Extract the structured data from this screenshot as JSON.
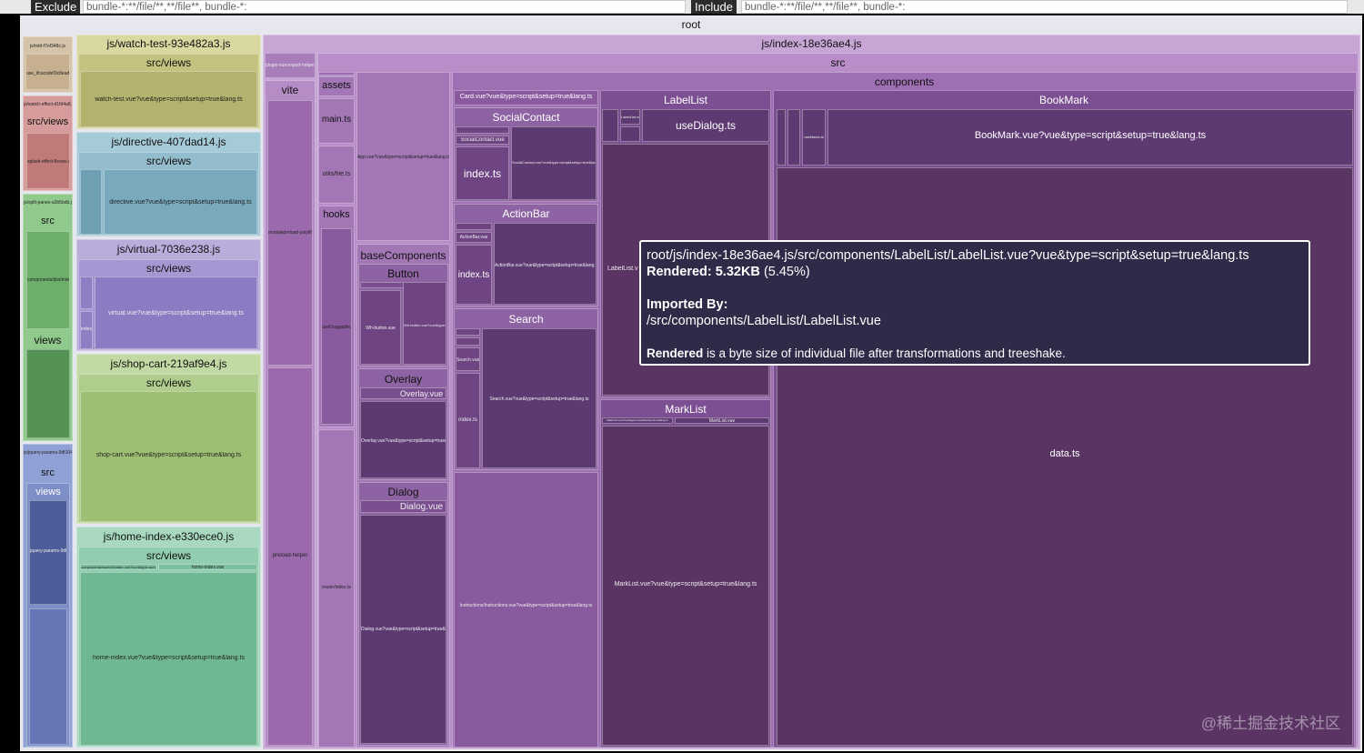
{
  "filters": {
    "exclude_label": "Exclude",
    "exclude_value": "bundle-*:**/file/**,**/file**, bundle-*:",
    "include_label": "Include",
    "include_value": "bundle-*:**/file/**,**/file**, bundle-*:"
  },
  "treemap": {
    "root": "root",
    "left_chunks": {
      "mitt": "js/mitt-f7ef348c.js",
      "mitt_sub": "use_ifcacodef3c8eaddfc.ts",
      "splash": "js/watch-effect-d1fd4a8.js",
      "splash_views": "src/views",
      "splash_child": "splash-effect-flexes.vue",
      "splitpane": "js/split-panes-a2b5bdb.js",
      "splitpane_src": "src",
      "splitpane_child": "components/dist/index.js",
      "splitpane_views": "views",
      "jquery": "js/jquery-params-9df1040.js",
      "jquery_src": "src",
      "jquery_views": "views",
      "jquery_child": "jquery-params-9df1040.vue"
    },
    "watch_test": {
      "title": "js/watch-test-93e482a3.js",
      "views": "src/views",
      "file": "watch-test.vue?vue&type=script&setup=true&lang.ts"
    },
    "directive": {
      "title": "js/directive-407dad14.js",
      "views": "src/views",
      "file": "directive.vue?vue&type=script&setup=true&lang.ts"
    },
    "virtual": {
      "title": "js/virtual-7036e238.js",
      "views": "src/views",
      "file": "virtual.vue?vue&type=script&setup=true&lang.ts",
      "small": "index.ts"
    },
    "shop_cart": {
      "title": "js/shop-cart-219af9e4.js",
      "views": "src/views",
      "file": "shop-cart.vue?vue&type=script&setup=true&lang.ts"
    },
    "home_index": {
      "title": "js/home-index-e330ece0.js",
      "views": "src/views",
      "sub1": "components/HomeHeader.vue?vue&type=script&setup=true&lang.ts",
      "sub2": "home-index.vue",
      "file": "home-index.vue?vue&type=script&setup=true&lang.ts"
    },
    "index_chunk": {
      "title": "js/index-18e36ae4.js",
      "src": "src",
      "components": "components",
      "plugin": "plugin-vue:export-helper",
      "vite": "vite",
      "vite_child1": "modulepreload-polyfill",
      "vite_child2": "preload-helper",
      "assets": "assets",
      "main": "main.ts",
      "app": "App.vue?vue&type=script&setup=true&lang.ts",
      "utils": "utils/file.ts",
      "hooks": "hooks",
      "hooks_child": "useDraggable.ts",
      "router": "router/index.ts",
      "base_components": "baseComponents",
      "button": "Button",
      "button_file": "Wh-button.vue",
      "button_file2": "Wh-button.vue?vue&type=script&setup=true&lang.ts",
      "overlay": "Overlay",
      "overlay_vue": "Overlay.vue",
      "overlay_file": "Overlay.vue?vue&type=script&setup=true&lang.ts",
      "dialog": "Dialog",
      "dialog_vue": "Dialog.vue",
      "dialog_file": "Dialog.vue?vue&type=script&setup=true&lang.ts",
      "card": "Card.vue?vue&type=script&setup=true&lang.ts",
      "social_contact": "SocialContact",
      "social_vue": "SocialContact.vue",
      "social_index": "index.ts",
      "social_file": "SocialContact.vue?vue&type=script&setup=true&lang.ts",
      "action_bar": "ActionBar",
      "action_vue": "ActionBar.vue",
      "action_index": "index.ts",
      "action_file": "ActionBar.vue?vue&type=script&setup=true&lang.ts",
      "search": "Search",
      "search_vue": "Search.vue",
      "search_index": "index.ts",
      "search_file": "Search.vue?vue&type=script&setup=true&lang.ts",
      "instructions": "Instructions/Instructions.vue?vue&type=script&setup=true&lang.ts",
      "label_list": "LabelList",
      "label_list_vue": "LabelList.vue",
      "use_dialog": "useDialog.ts",
      "label_list_file": "LabelList.v",
      "mark_list": "MarkList",
      "mark_list_vue": "MarkList.vue",
      "mark_list_sub": "MarkList.vue?vue&type=script&setup=true&lang.ts",
      "mark_list_file": "MarkList.vue?vue&type=script&setup=true&lang.ts",
      "bookmark": "BookMark",
      "bookmark_vue": "useMarks.ts",
      "bookmark_file": "BookMark.vue?vue&type=script&setup=true&lang.ts",
      "data": "data.ts"
    }
  },
  "tooltip": {
    "path": "root/js/index-18e36ae4.js/src/components/LabelList/LabelList.vue?vue&type=script&setup=true&lang.ts",
    "rendered_label": "Rendered: 5.32KB",
    "rendered_pct": "(5.45%)",
    "imported_by_label": "Imported By:",
    "imported_by_value": "/src/components/LabelList/LabelList.vue",
    "note_bold": "Rendered",
    "note_text": " is a byte size of individual file after transformations and treeshake."
  },
  "watermark": "@稀土掘金技术社区",
  "colors": {
    "watch_test": "#bdbd78",
    "directive": "#8cb6c6",
    "virtual": "#9c8fc9",
    "shop_cart": "#a8c77c",
    "home_index": "#7fc3a2",
    "index_chunk": "#a77dba",
    "dark_purple": "#5a3564"
  }
}
